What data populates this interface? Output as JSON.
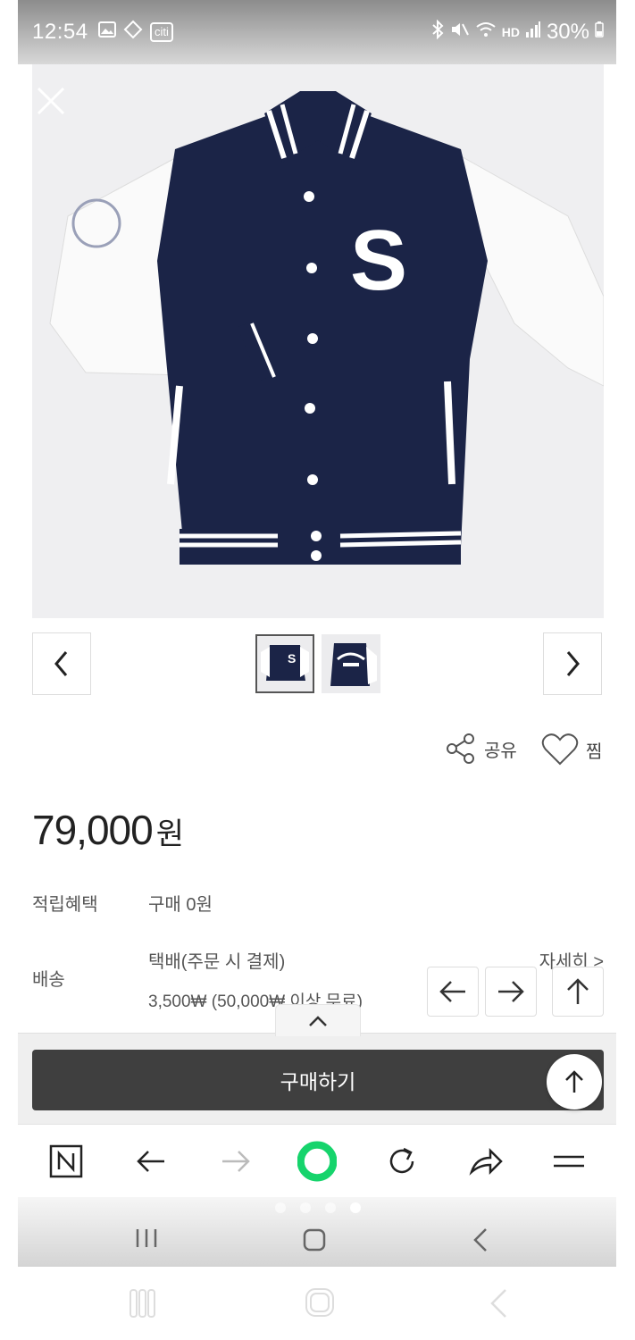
{
  "status_bar": {
    "time": "12:54",
    "carrier_badge": "citi",
    "network": "HD",
    "battery": "30%"
  },
  "gallery": {
    "thumbnails": [
      "jacket-front",
      "jacket-back"
    ]
  },
  "actions": {
    "share_label": "공유",
    "wish_label": "찜"
  },
  "product": {
    "price": "79,000",
    "price_unit": "원",
    "points_label": "적립혜택",
    "points_value": "구매 0원",
    "shipping_label": "배송",
    "shipping_method": "택배(주문 시 결제)",
    "shipping_fee": "3,500₩ (50,000₩ 이상 무료)",
    "detail_link": "자세히 >"
  },
  "buy": {
    "button_label": "구매하기"
  },
  "browser_toolbar": {
    "items": [
      "naver-home",
      "back",
      "forward",
      "green-dot",
      "refresh",
      "share",
      "menu"
    ]
  },
  "colors": {
    "navy": "#1b2447",
    "buy_button": "#3f3f3f",
    "green": "#16d46c"
  }
}
